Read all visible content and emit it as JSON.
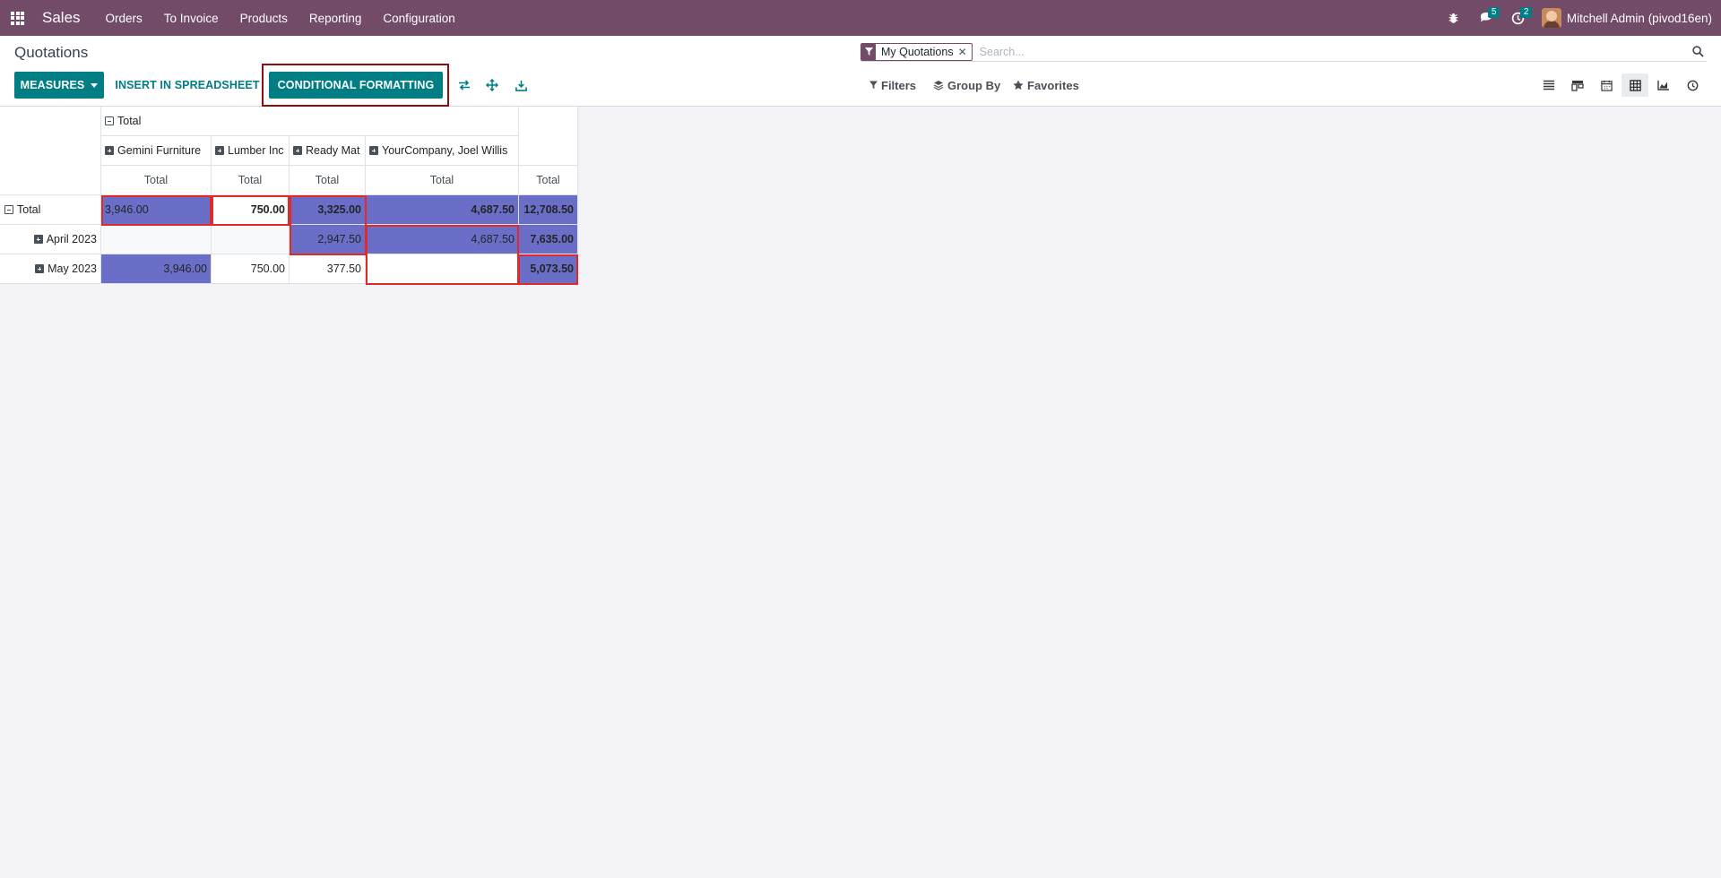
{
  "navbar": {
    "brand": "Sales",
    "menu": [
      "Orders",
      "To Invoice",
      "Products",
      "Reporting",
      "Configuration"
    ],
    "messages_badge": "5",
    "activities_badge": "2",
    "user": "Mitchell Admin (pivod16en)"
  },
  "control_panel": {
    "title": "Quotations",
    "measures_label": "MEASURES",
    "insert_label": "INSERT IN SPREADSHEET",
    "conditional_label": "CONDITIONAL FORMATTING",
    "facet": "My Quotations",
    "search_placeholder": "Search...",
    "filters_label": "Filters",
    "groupby_label": "Group By",
    "favorites_label": "Favorites"
  },
  "pivot": {
    "col_group_header": "Total",
    "col_groups": [
      "Gemini Furniture",
      "Lumber Inc",
      "Ready Mat",
      "YourCompany, Joel Willis"
    ],
    "measure_label": "Total",
    "grand_total_label": "Total",
    "rows": [
      {
        "label": "Total",
        "values": [
          "3,946.00",
          "750.00",
          "3,325.00",
          "4,687.50"
        ],
        "total": "12,708.50"
      },
      {
        "label": "April 2023",
        "values": [
          "",
          "",
          "2,947.50",
          "4,687.50"
        ],
        "total": "7,635.00"
      },
      {
        "label": "May 2023",
        "values": [
          "3,946.00",
          "750.00",
          "377.50",
          ""
        ],
        "total": "5,073.50"
      }
    ]
  }
}
